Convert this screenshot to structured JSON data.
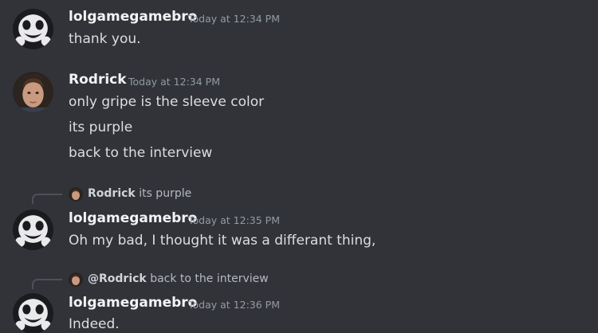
{
  "messages": [
    {
      "username": "lolgamegamebro",
      "timestamp": "Today at 12:34 PM",
      "avatar_icon": "skull-mascot-avatar",
      "lines": [
        "thank you."
      ]
    },
    {
      "username": "Rodrick",
      "timestamp": "Today at 12:34 PM",
      "avatar_icon": "rodrick-photo-avatar",
      "lines": [
        "only gripe is the sleeve color",
        "its purple",
        "back to the interview"
      ]
    },
    {
      "reply": {
        "name": "Rodrick",
        "text": "its purple"
      },
      "username": "lolgamegamebro",
      "timestamp": "Today at 12:35 PM",
      "avatar_icon": "skull-mascot-avatar",
      "lines": [
        "Oh my bad, I thought it was a differant thing,"
      ]
    },
    {
      "reply": {
        "name": "@Rodrick",
        "text": "back to the interview"
      },
      "username": "lolgamegamebro",
      "timestamp": "Today at 12:36 PM",
      "avatar_icon": "skull-mascot-avatar",
      "lines": [
        "Indeed."
      ]
    }
  ]
}
